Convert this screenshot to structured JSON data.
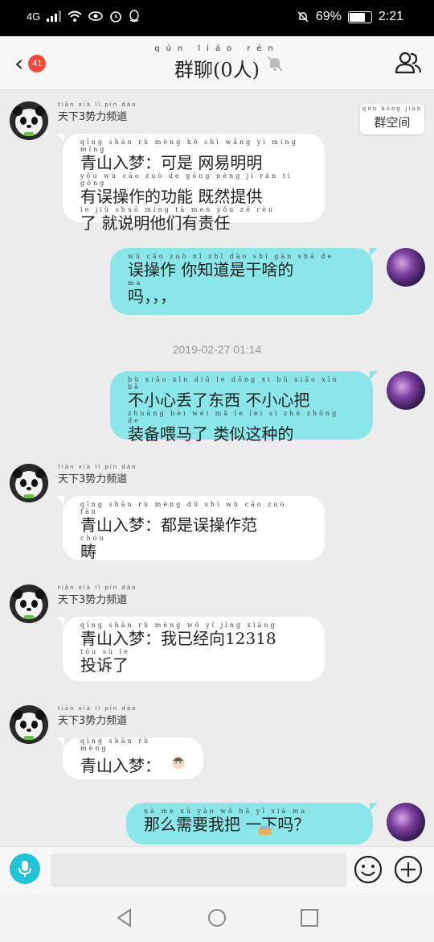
{
  "status_bar": {
    "network": "4G",
    "battery": "69%",
    "battery_level": 0.69,
    "time": "2:21"
  },
  "header": {
    "back_badge": "41",
    "title_pinyin": "qún liáo rén",
    "title": "群聊(0人)"
  },
  "group_space": {
    "pinyin": "qún kōng jiān",
    "label": "群空间"
  },
  "messages": [
    {
      "direction": "in",
      "sender_pinyin": "tiān xià lì pín dào",
      "sender": "天下3势力频道",
      "lines": [
        {
          "py": "qīng shān rù mèng       kě shì  wǎng yì míng míng",
          "text": "青山入梦：可是 网易明明"
        },
        {
          "py": "yǒu  wù cāo zuò  de gōng néng    jì  rán  tí gōng",
          "text": "有误操作的功能 既然提供"
        },
        {
          "py": "le    jiù shuō míng tā  men yǒu  zé  rèn",
          "text": "了 就说明他们有责任"
        }
      ]
    },
    {
      "direction": "out",
      "lines": [
        {
          "py": "wù cāo zuò   nǐ zhī dào shì gàn shá de",
          "text": "误操作 你知道是干啥的"
        },
        {
          "py": "ma",
          "text": "吗，，，"
        }
      ]
    },
    {
      "direction": "out",
      "lines": [
        {
          "py": "bù xiǎo xīn diū le dōng xi   bù xiǎo xīn bǎ",
          "text": "不小心丢了东西 不小心把"
        },
        {
          "py": "zhuāng bèi wèi mǎ le   lèi  sì zhè zhǒng de",
          "text": "装备喂马了 类似这种的"
        }
      ]
    },
    {
      "direction": "in",
      "sender_pinyin": "tiān xià lì pín dào",
      "sender": "天下3势力频道",
      "lines": [
        {
          "py": "qīng shān rù mèng      dū shì wù cāo zuò fàn",
          "text": "青山入梦：都是误操作范"
        },
        {
          "py": "chóu",
          "text": "畴"
        }
      ]
    },
    {
      "direction": "in",
      "sender_pinyin": "tiān xià lì pín dào",
      "sender": "天下3势力频道",
      "lines": [
        {
          "py": "qīng shān rù mèng      wǒ  yǐ  jīng xiàng",
          "text": "青山入梦：我已经向12318"
        },
        {
          "py": "tóu  sù  le",
          "text": "投诉了"
        }
      ]
    },
    {
      "direction": "in",
      "sender_pinyin": "tiān xià lì pín dào",
      "sender": "天下3势力频道",
      "lines": [
        {
          "py": "qīng shān rù mèng",
          "text": "青山入梦："
        }
      ]
    },
    {
      "direction": "out",
      "lines": [
        {
          "py": "nà  me  xū yào wǒ  bǎ       yī xià  ma",
          "text": "那么需要我把   一下吗？"
        }
      ]
    }
  ],
  "timestamp": "2019-02-27 01:14",
  "input": {
    "placeholder": ""
  },
  "colors": {
    "outgoing_bubble": "#8be6ea",
    "incoming_bubble": "#ffffff",
    "badge": "#f24b3b",
    "mic": "#22c3d6"
  }
}
